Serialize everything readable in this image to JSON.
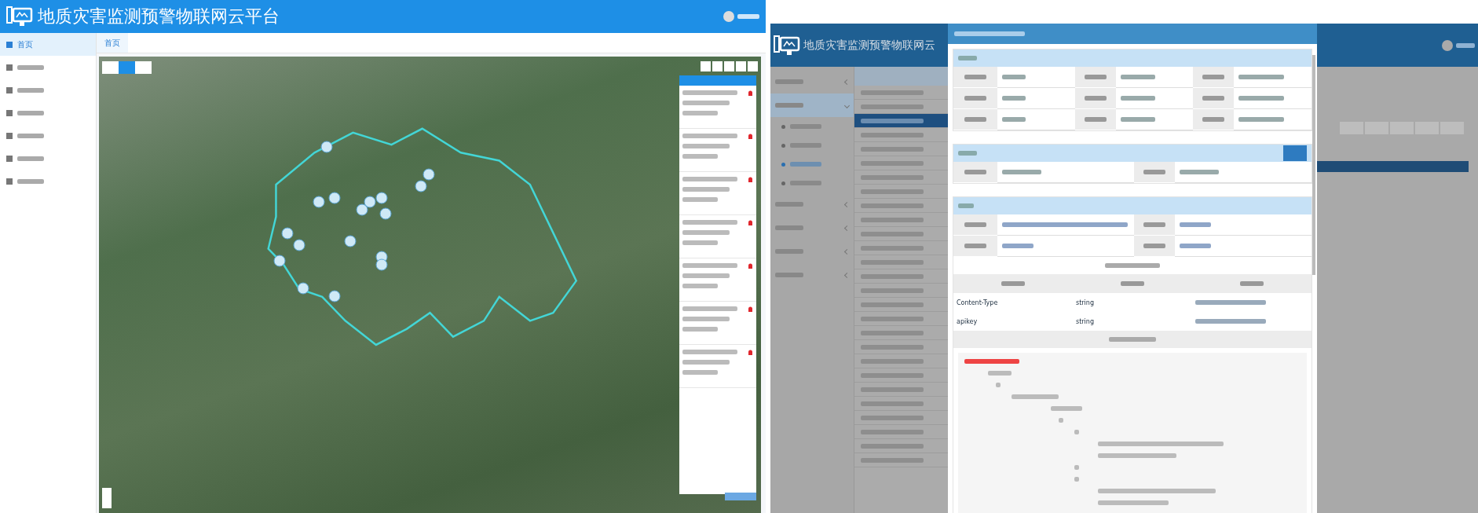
{
  "left": {
    "header": {
      "title": "地质灾害监测预警物联网云平台"
    },
    "sidebar": {
      "items": [
        {
          "label": "首页",
          "selected": true
        },
        {
          "selected": false
        },
        {
          "selected": false
        },
        {
          "selected": false
        },
        {
          "selected": false
        },
        {
          "selected": false
        },
        {
          "selected": false
        }
      ]
    },
    "tabs": [
      {
        "label": "首页",
        "selected": true
      }
    ],
    "map_types": [
      {
        "selected": false
      },
      {
        "selected": true
      },
      {
        "selected": false
      }
    ],
    "alerts": [
      {
        "kind": "alarm"
      },
      {
        "kind": "alarm"
      },
      {
        "kind": "alarm"
      },
      {
        "kind": "alarm"
      },
      {
        "kind": "alarm"
      },
      {
        "kind": "alarm"
      },
      {
        "kind": "alarm"
      }
    ]
  },
  "right": {
    "header": {
      "title": "地质灾害监测预警物联网云"
    },
    "sidebar": {
      "items": [
        {
          "selected": false,
          "expanded": false
        },
        {
          "selected": true,
          "expanded": true,
          "children": [
            {
              "selected": false
            },
            {
              "selected": false
            },
            {
              "selected": true
            },
            {
              "selected": false
            }
          ]
        },
        {
          "selected": false,
          "expanded": false
        },
        {
          "selected": false,
          "expanded": false
        },
        {
          "selected": false,
          "expanded": false
        },
        {
          "selected": false,
          "expanded": false
        }
      ]
    },
    "list": {
      "rows": [
        {
          "selected": false
        },
        {
          "selected": false
        },
        {
          "selected": true
        },
        {
          "selected": false
        },
        {
          "selected": false
        },
        {
          "selected": false
        },
        {
          "selected": false
        },
        {
          "selected": false
        },
        {
          "selected": false
        },
        {
          "selected": false
        },
        {
          "selected": false
        },
        {
          "selected": false
        },
        {
          "selected": false
        },
        {
          "selected": false
        },
        {
          "selected": false
        },
        {
          "selected": false
        },
        {
          "selected": false
        },
        {
          "selected": false
        },
        {
          "selected": false
        },
        {
          "selected": false
        },
        {
          "selected": false
        },
        {
          "selected": false
        },
        {
          "selected": false
        },
        {
          "selected": false
        },
        {
          "selected": false
        },
        {
          "selected": false
        },
        {
          "selected": false
        }
      ]
    },
    "modal": {
      "params": [
        {
          "name": "Content-Type",
          "type": "string"
        },
        {
          "name": "apikey",
          "type": "string"
        }
      ]
    }
  }
}
